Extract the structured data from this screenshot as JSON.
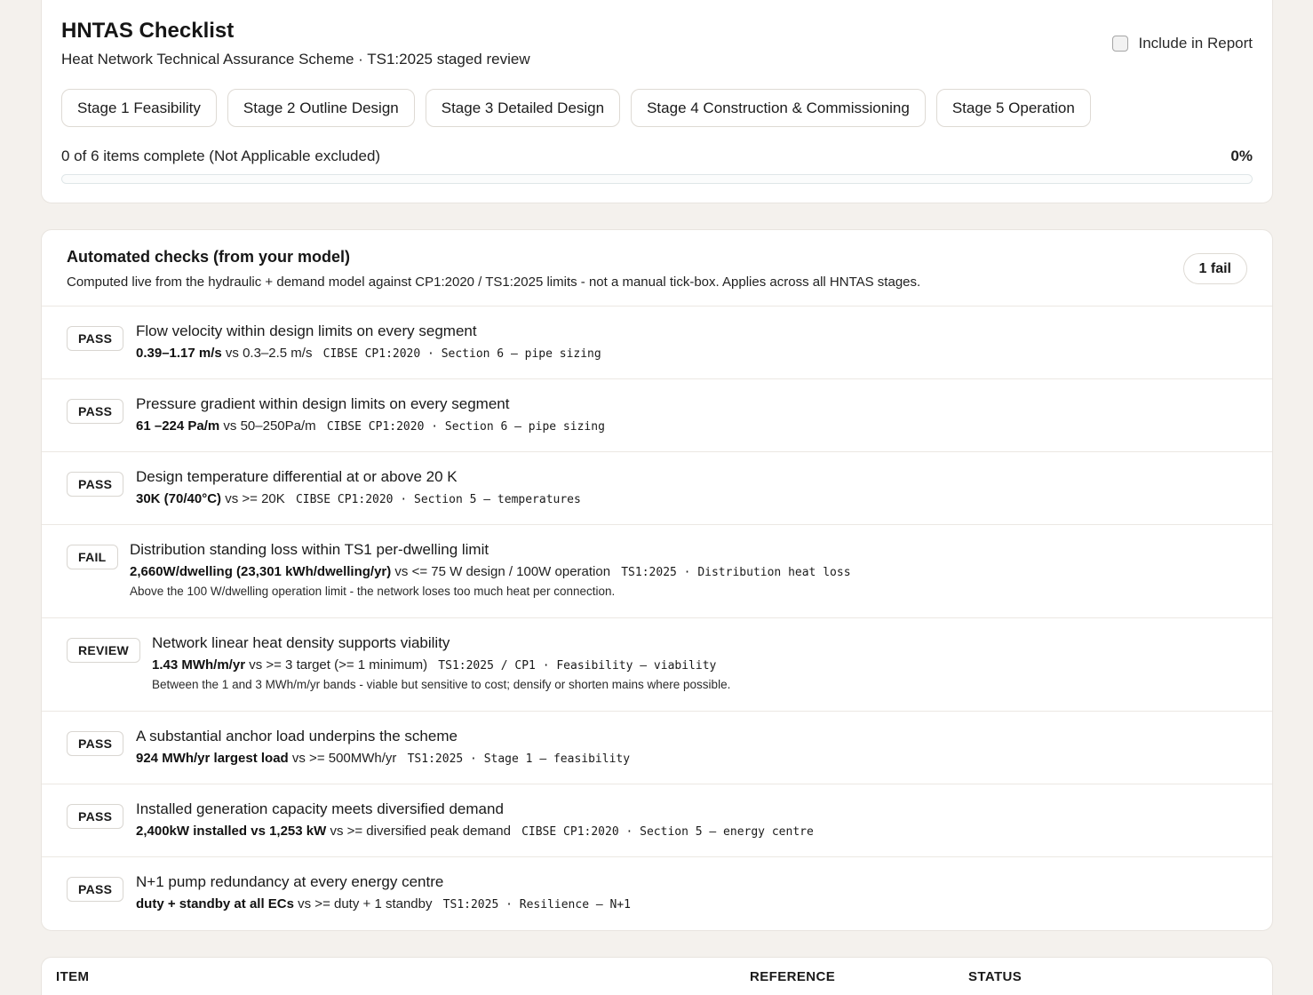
{
  "checklist": {
    "title": "HNTAS Checklist",
    "subtitle": "Heat Network Technical Assurance Scheme · TS1:2025 staged review",
    "include_label": "Include in Report",
    "include_checked": false,
    "stages": [
      "Stage 1 Feasibility",
      "Stage 2 Outline Design",
      "Stage 3 Detailed Design",
      "Stage 4 Construction & Commissioning",
      "Stage 5 Operation"
    ],
    "progress_text": "0 of 6 items complete (Not Applicable excluded)",
    "progress_pct": "0%",
    "progress_fraction": 0
  },
  "automated": {
    "title": "Automated checks (from your model)",
    "description": "Computed live from the hydraulic + demand model against CP1:2020 / TS1:2025 limits - not a manual tick-box. Applies across all HNTAS stages.",
    "fail_count_label": "1 fail",
    "checks": [
      {
        "status": "PASS",
        "title": "Flow velocity within design limits on every segment",
        "value": "0.39–1.17   m/s",
        "limit": "vs 0.3–2.5 m/s",
        "reference": "CIBSE CP1:2020 · Section 6 — pipe sizing",
        "note": ""
      },
      {
        "status": "PASS",
        "title": "Pressure gradient within design limits on every segment",
        "value": "61 –224 Pa/m",
        "limit": "vs 50–250Pa/m",
        "reference": "CIBSE CP1:2020 · Section 6 — pipe sizing",
        "note": ""
      },
      {
        "status": "PASS",
        "title": "Design temperature differential at or above 20 K",
        "value": "30K (70/40°C)",
        "limit": "vs >= 20K",
        "reference": "CIBSE CP1:2020 · Section 5 — temperatures",
        "note": ""
      },
      {
        "status": "FAIL",
        "title": "Distribution standing loss within TS1 per-dwelling limit",
        "value": "2,660W/dwelling (23,301 kWh/dwelling/yr)",
        "limit": "vs <= 75 W design / 100W operation",
        "reference": "TS1:2025 · Distribution heat loss",
        "note": "Above the 100 W/dwelling operation limit - the network loses too much heat per connection."
      },
      {
        "status": "REVIEW",
        "title": "Network linear heat density supports viability",
        "value": "1.43 MWh/m/yr",
        "limit": "vs >= 3 target (>= 1 minimum)",
        "reference": "TS1:2025 / CP1 · Feasibility — viability",
        "note": "Between the 1 and 3 MWh/m/yr bands - viable but sensitive to cost; densify or shorten mains where possible."
      },
      {
        "status": "PASS",
        "title": "A substantial anchor load underpins the scheme",
        "value": "924 MWh/yr largest load",
        "limit": "vs >= 500MWh/yr",
        "reference": "TS1:2025 · Stage 1 — feasibility",
        "note": ""
      },
      {
        "status": "PASS",
        "title": "Installed generation capacity meets diversified demand",
        "value": "2,400kW installed vs 1,253  kW",
        "limit": "vs >= diversified peak demand",
        "reference": "CIBSE CP1:2020 · Section 5 — energy centre",
        "note": ""
      },
      {
        "status": "PASS",
        "title": "N+1 pump redundancy at every energy centre",
        "value": "duty + standby at all ECs",
        "limit": "vs >= duty + 1  standby",
        "reference": "TS1:2025 · Resilience — N+1",
        "note": ""
      }
    ]
  },
  "table": {
    "headers": [
      "ITEM",
      "REFERENCE",
      "STATUS"
    ]
  }
}
